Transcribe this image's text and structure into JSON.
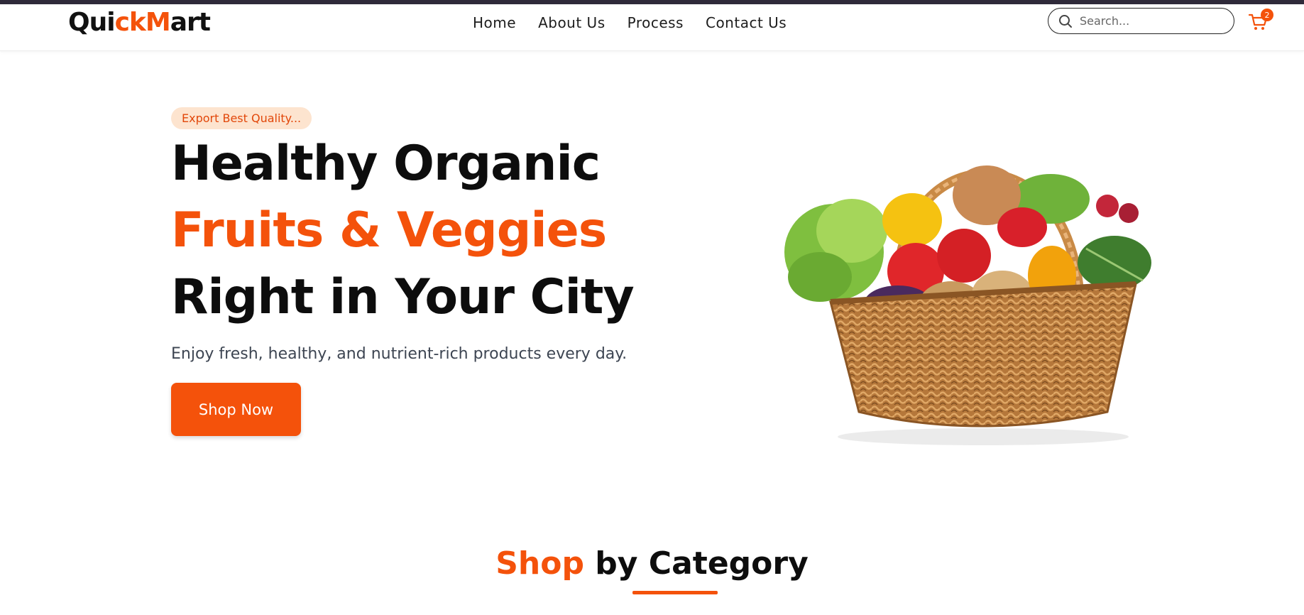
{
  "brand": {
    "logo_part1": "Qui",
    "logo_part2": "ck",
    "logo_part3": "M",
    "logo_part4": "art"
  },
  "nav": {
    "links": [
      {
        "label": "Home"
      },
      {
        "label": "About Us"
      },
      {
        "label": "Process"
      },
      {
        "label": "Contact Us"
      }
    ],
    "search": {
      "placeholder": "Search..."
    },
    "cart": {
      "count": "2"
    }
  },
  "hero": {
    "badge": "Export Best Quality...",
    "headline_line1": "Healthy Organic",
    "headline_line2": "Fruits & Veggies",
    "headline_line3": "Right in Your City",
    "subtitle": "Enjoy fresh, healthy, and nutrient-rich products every day.",
    "cta_label": "Shop Now"
  },
  "section": {
    "title_accent": "Shop",
    "title_rest": " by Category"
  },
  "colors": {
    "accent": "#f4520b",
    "badge_bg": "#fde4cf",
    "topbar": "#2f2a3a"
  }
}
